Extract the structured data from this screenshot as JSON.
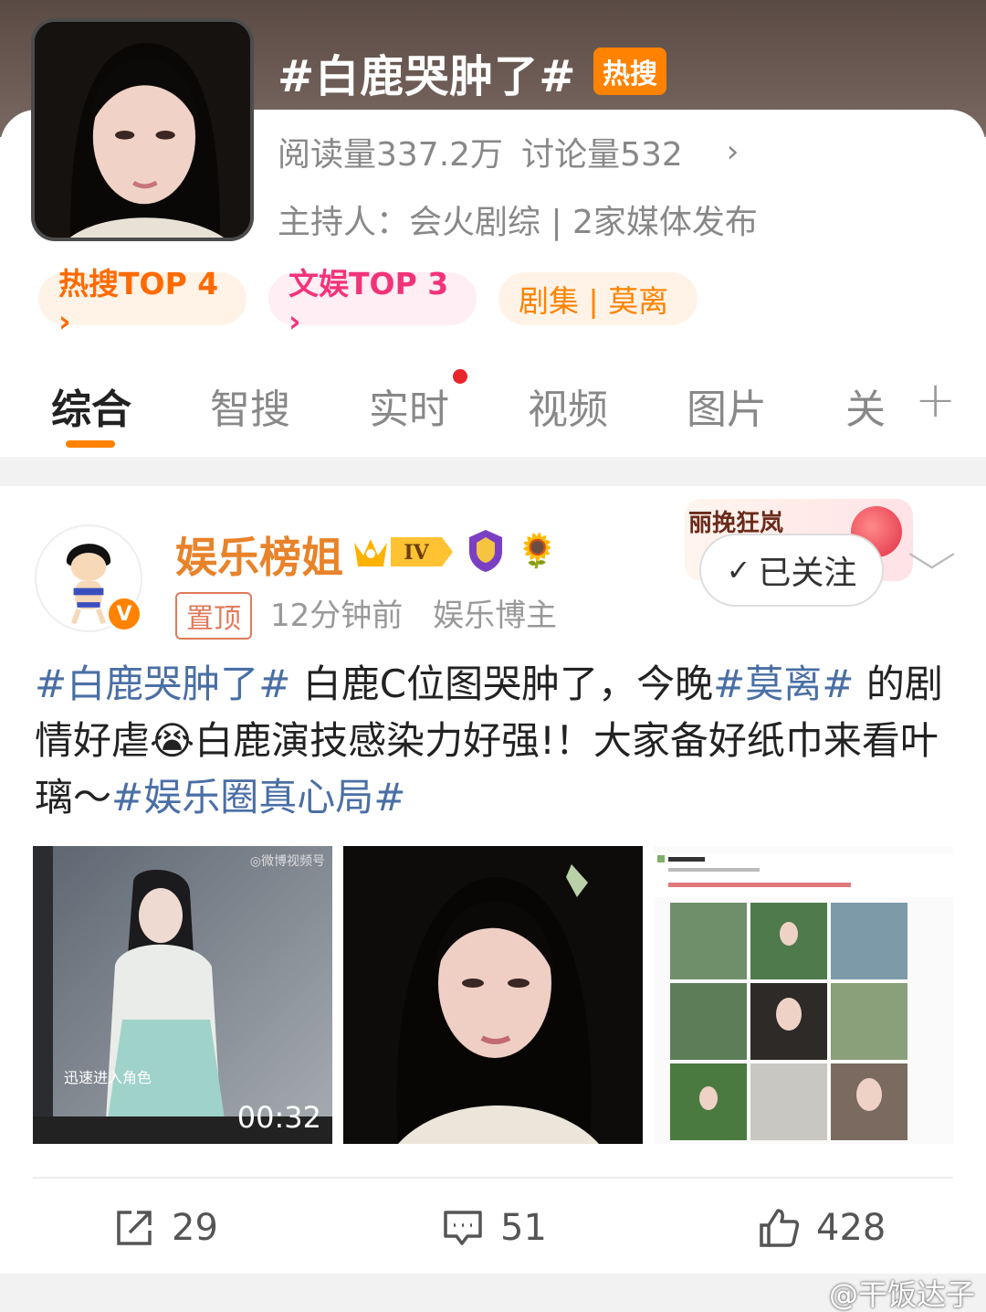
{
  "header": {
    "topic_title": "#白鹿哭肿了#",
    "hot_badge": "热搜",
    "read_count": "阅读量337.2万",
    "discussion_count": "讨论量532",
    "host_line": "主持人：会火剧综 | 2家媒体发布"
  },
  "pills": {
    "hot_rank": "热搜TOP 4 ›",
    "ent_rank": "文娱TOP 3 ›",
    "series": "剧集 | 莫离"
  },
  "tabs": [
    {
      "label": "综合",
      "active": true
    },
    {
      "label": "智搜"
    },
    {
      "label": "实时"
    },
    {
      "label": "视频"
    },
    {
      "label": "图片"
    },
    {
      "label": "关"
    }
  ],
  "post": {
    "username": "娱乐榜姐",
    "level_badge": "IV",
    "pin_tag": "置顶",
    "time": "12分钟前",
    "author_type": "娱乐博主",
    "sticker_text": "丽挽狂岚",
    "follow_label": "已关注",
    "text": {
      "tag1": "#白鹿哭肿了#",
      "part1": " 白鹿C位图哭肿了，今晚",
      "tag2": "#莫离#",
      "part2": " 的剧情好虐",
      "emoji": "😭",
      "part3": "白鹿演技感染力好强!！大家备好纸巾来看叶璃～",
      "tag3": "#娱乐圈真心局#"
    },
    "video_duration": "00:32",
    "video_logo": "◎微博视频号",
    "video_caption": "迅速进入角色",
    "actions": {
      "shares": "29",
      "comments": "51",
      "likes": "428"
    }
  },
  "watermark": "@干饭达子",
  "colors": {
    "accent": "#ff8200",
    "hashtag": "#4a6fa5",
    "username": "#e8832a"
  }
}
